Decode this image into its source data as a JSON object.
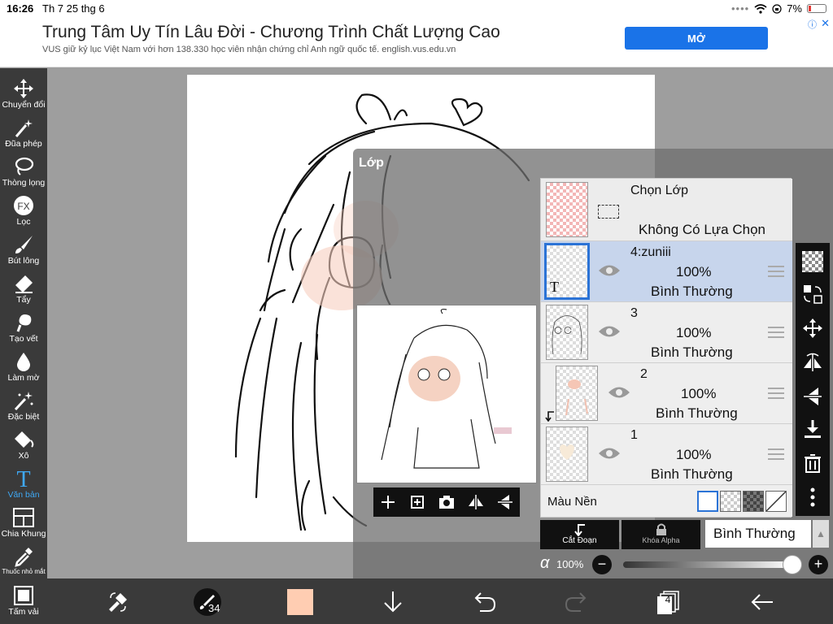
{
  "status_bar": {
    "time": "16:26",
    "date": "Th 7 25 thg 6",
    "battery": "7%"
  },
  "ad": {
    "title": "Trung Tâm Uy Tín Lâu Đời - Chương Trình Chất Lượng Cao",
    "subtitle": "VUS giữ kỷ lục Việt Nam với hơn 138.330 học viên nhận chứng chỉ Anh ngữ quốc tế. english.vus.edu.vn",
    "button": "MỞ",
    "close": "✕"
  },
  "tools": [
    {
      "label": "Chuyển đổi",
      "icon": "move-icon"
    },
    {
      "label": "Đũa phép",
      "icon": "magic-wand-icon"
    },
    {
      "label": "Thòng lọng",
      "icon": "lasso-icon"
    },
    {
      "label": "Lọc",
      "icon": "fx-icon"
    },
    {
      "label": "Bút lông",
      "icon": "brush-icon"
    },
    {
      "label": "Tẩy",
      "icon": "eraser-icon"
    },
    {
      "label": "Tạo vết",
      "icon": "smudge-icon"
    },
    {
      "label": "Làm mờ",
      "icon": "blur-icon"
    },
    {
      "label": "Đặc biệt",
      "icon": "special-icon"
    },
    {
      "label": "Xô",
      "icon": "bucket-icon"
    },
    {
      "label": "Văn bản",
      "icon": "text-icon",
      "active": true
    },
    {
      "label": "Chia Khung",
      "icon": "frame-divider-icon"
    },
    {
      "label": "Thuốc nhỏ mắt",
      "icon": "eyedropper-icon"
    },
    {
      "label": "Tấm vải",
      "icon": "canvas-icon"
    }
  ],
  "fx_text": "FX",
  "text_tool_glyph": "T",
  "panel": {
    "title": "Lớp",
    "selection": {
      "title": "Chọn Lớp",
      "status": "Không Có Lựa Chọn"
    },
    "layers": [
      {
        "name": "4:zuniii",
        "opacity": "100%",
        "mode": "Bình Thường",
        "selected": true,
        "thumb_glyph": "T"
      },
      {
        "name": "3",
        "opacity": "100%",
        "mode": "Bình Thường",
        "selected": false
      },
      {
        "name": "2",
        "opacity": "100%",
        "mode": "Bình Thường",
        "selected": false
      },
      {
        "name": "1",
        "opacity": "100%",
        "mode": "Bình Thường",
        "selected": false
      }
    ],
    "background_label": "Màu Nền",
    "clip_label": "Cắt Đoạn",
    "lock_label": "Khóa Alpha",
    "blend_mode": "Bình Thường",
    "alpha_symbol": "α",
    "alpha_value": "100%",
    "alpha_fraction": 1.0,
    "minus": "−",
    "plus": "+"
  },
  "bottom": {
    "brush_size": "34",
    "layer_count": "4",
    "color": "#ffcdb2"
  },
  "colors": {
    "accent": "#3fa9f5",
    "selected_row": "#c7d5ec",
    "toolbar": "#3a3a3a"
  }
}
